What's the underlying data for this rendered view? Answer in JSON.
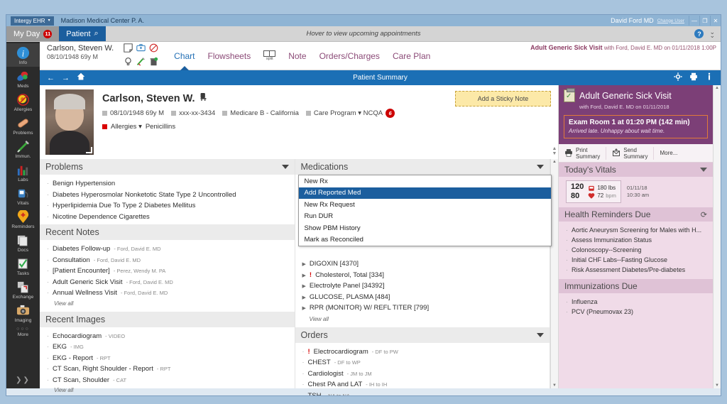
{
  "titlebar": {
    "brand": "Intergy EHR",
    "brand_caret": "▾",
    "practice": "Madison Medical Center P. A.",
    "user": "David Ford MD",
    "change_user": "Change User",
    "minimize": "—",
    "maximize": "❐",
    "close": "✕"
  },
  "tabstrip": {
    "my_day": "My Day",
    "my_day_count": "11",
    "patient": "Patient",
    "search_icon": "search-icon",
    "hint": "Hover to view upcoming appointments",
    "help": "?",
    "expand": "⌄"
  },
  "rail": {
    "items": [
      {
        "label": "Info",
        "icon": "info-icon"
      },
      {
        "label": "Meds",
        "icon": "pills-icon"
      },
      {
        "label": "Allergies",
        "icon": "allergy-icon"
      },
      {
        "label": "Problems",
        "icon": "bandage-icon"
      },
      {
        "label": "Immun.",
        "icon": "syringe-icon"
      },
      {
        "label": "Labs",
        "icon": "bar-chart-icon"
      },
      {
        "label": "Vitals",
        "icon": "bp-cuff-icon"
      },
      {
        "label": "Reminders",
        "icon": "pin-heart-icon"
      },
      {
        "label": "Docs",
        "icon": "documents-icon"
      },
      {
        "label": "Tasks",
        "icon": "checklist-icon"
      },
      {
        "label": "Exchange",
        "icon": "exchange-icon"
      },
      {
        "label": "Imaging",
        "icon": "camera-icon"
      },
      {
        "label": "More",
        "icon": "more-dots-icon"
      }
    ],
    "more_dots": "○○○",
    "expand": "❯❯"
  },
  "patient_header": {
    "name": "Carlson, Steven W.",
    "dob_line": "08/10/1948  69y M",
    "icons_row1": [
      "note-icon",
      "camera-badge-icon",
      "no-entry-icon"
    ],
    "icons_row2": [
      "lightbulb-icon",
      "syringe-green-icon",
      "trash-icon"
    ],
    "tabs": [
      {
        "label": "Chart",
        "active": true
      },
      {
        "label": "Flowsheets",
        "active": false
      },
      {
        "label": "Note",
        "active": false
      },
      {
        "label": "Orders/Charges",
        "active": false
      },
      {
        "label": "Care Plan",
        "active": false
      }
    ],
    "split_label": "split",
    "visit_title": "Adult Generic Sick Visit",
    "visit_detail": "with Ford, David E. MD  on 01/11/2018 1:00P"
  },
  "navbar": {
    "back": "←",
    "forward": "→",
    "home": "home-icon",
    "title": "Patient Summary",
    "gear": "gear-icon",
    "print": "print-icon",
    "info": "info-icon"
  },
  "banner": {
    "name": "Carlson, Steven W.",
    "name_icon": "chair-icon",
    "meta": [
      "08/10/1948 69y M",
      "xxx-xx-3434",
      "Medicare B - California",
      "Care Program ▾  NCQA"
    ],
    "ncqa_badge": "6",
    "allergies_label": "Allergies ▾",
    "allergies_value": "Penicillins",
    "sticky_note": "Add a Sticky Note",
    "scroll_up": "▲",
    "scroll_down": "▼"
  },
  "problems": {
    "title": "Problems",
    "items": [
      "Benign Hypertension",
      "Diabetes Hyperosmolar Nonketotic State Type 2 Uncontrolled",
      "Hyperlipidemia Due To Type 2 Diabetes Mellitus",
      "Nicotine Dependence Cigarettes"
    ]
  },
  "recent_notes": {
    "title": "Recent Notes",
    "items": [
      {
        "name": "Diabetes Follow-up",
        "author": "- Ford, David E. MD"
      },
      {
        "name": "Consultation",
        "author": "- Ford, David E. MD"
      },
      {
        "name": "[Patient Encounter]",
        "author": "- Perez, Wendy M. PA"
      },
      {
        "name": "Adult Generic Sick Visit",
        "author": "- Ford, David E. MD"
      },
      {
        "name": "Annual Wellness Visit",
        "author": "- Ford, David E. MD"
      }
    ],
    "view_all": "View all"
  },
  "recent_images": {
    "title": "Recent Images",
    "items": [
      {
        "name": "Echocardiogram",
        "type": "- VIDEO"
      },
      {
        "name": "EKG",
        "type": "- IMG"
      },
      {
        "name": "EKG - Report",
        "type": "- RPT"
      },
      {
        "name": "CT Scan, Right Shoulder - Report",
        "type": "- RPT"
      },
      {
        "name": "CT Scan, Shoulder",
        "type": "- CAT"
      }
    ],
    "view_all": "View all"
  },
  "medications": {
    "title": "Medications",
    "menu": [
      {
        "label": "New Rx",
        "selected": false
      },
      {
        "label": "Add Reported Med",
        "selected": true
      },
      {
        "label": "New Rx Request",
        "selected": false
      },
      {
        "label": "Run DUR",
        "selected": false
      },
      {
        "label": "Show PBM History",
        "selected": false
      },
      {
        "label": "Mark as Reconciled",
        "selected": false
      }
    ]
  },
  "labs": {
    "items": [
      {
        "name": "DIGOXIN [4370]",
        "alert": false
      },
      {
        "name": "Cholesterol, Total [334]",
        "alert": true
      },
      {
        "name": "Electrolyte Panel [34392]",
        "alert": false
      },
      {
        "name": "GLUCOSE, PLASMA [484]",
        "alert": false
      },
      {
        "name": "RPR (MONITOR) W/ REFL TITER [799]",
        "alert": false
      }
    ],
    "view_all": "View all"
  },
  "orders": {
    "title": "Orders",
    "items": [
      {
        "name": "Electrocardiogram",
        "detail": "- DF to PW",
        "alert": true
      },
      {
        "name": "CHEST",
        "detail": "- DF to WP",
        "alert": false
      },
      {
        "name": "Cardiologist",
        "detail": "- JM to JM",
        "alert": false
      },
      {
        "name": "Chest PA and LAT",
        "detail": "- IH to IH",
        "alert": false
      },
      {
        "name": "TSH",
        "detail": "- NA to NA",
        "alert": false
      }
    ]
  },
  "visit_card": {
    "icon": "clipboard-icon",
    "title": "Adult Generic Sick Visit",
    "subtitle": "with Ford, David E. MD on 01/11/2018",
    "exam_room": "Exam Room 1 at 01:20 PM  (142 min)",
    "exam_note": "Arrived late. Unhappy about wait time.",
    "actions": [
      {
        "line1": "Print",
        "line2": "Summary",
        "icon": "printer-icon"
      },
      {
        "line1": "Send",
        "line2": "Summary",
        "icon": "send-icon"
      },
      {
        "line1": "More...",
        "line2": "",
        "icon": ""
      }
    ]
  },
  "todays_vitals": {
    "title": "Today's Vitals",
    "bp_systolic": "120",
    "bp_diastolic": "80",
    "weight": "180 lbs",
    "weight_icon": "scale-icon",
    "pulse": "72",
    "pulse_unit": "bpm",
    "pulse_icon": "heart-icon",
    "date": "01/11/18",
    "time": "10:30 am"
  },
  "health_reminders": {
    "title": "Health Reminders Due",
    "refresh_icon": "refresh-icon",
    "items": [
      "Aortic Aneurysm Screening for Males with H...",
      "Assess Immunization Status",
      "Colonoscopy--Screening",
      "Initial CHF Labs--Fasting Glucose",
      "Risk Assessment Diabetes/Pre-diabetes"
    ]
  },
  "immunizations": {
    "title": "Immunizations Due",
    "items": [
      "Influenza",
      "PCV (Pneumovax 23)"
    ]
  },
  "colors": {
    "accent_blue": "#1b6fb5",
    "title_blue": "#8fb4d4",
    "purple": "#7c3f77",
    "pink_panel": "#f0dbe8",
    "alert_red": "#d40000",
    "selected_blue": "#1b5e9e",
    "sticky_yellow": "#fce9a8"
  }
}
